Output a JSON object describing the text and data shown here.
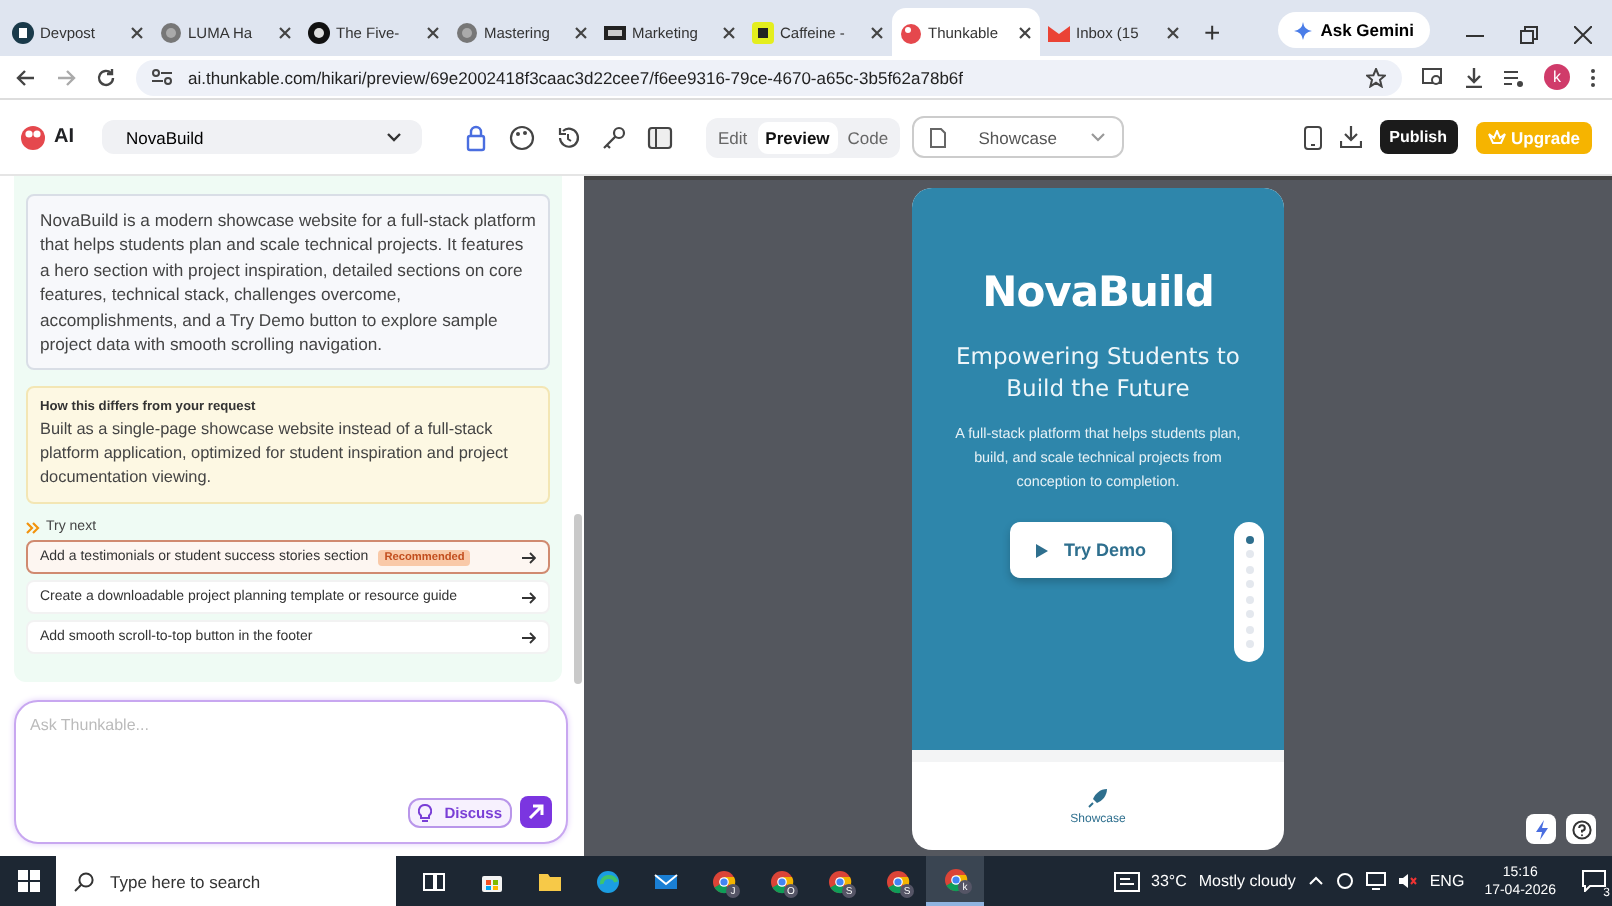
{
  "browser": {
    "tabs": [
      {
        "label": "Devpost",
        "selected": false,
        "kind": "d"
      },
      {
        "label": "LUMA Ha",
        "selected": false,
        "kind": "globe"
      },
      {
        "label": "The Five-",
        "selected": false,
        "kind": "circle"
      },
      {
        "label": "Mastering",
        "selected": false,
        "kind": "globe"
      },
      {
        "label": "Marketing",
        "selected": false,
        "kind": "wx"
      },
      {
        "label": "Caffeine -",
        "selected": false,
        "kind": "c"
      },
      {
        "label": "Thunkable",
        "selected": true,
        "kind": "thunk"
      },
      {
        "label": "Inbox (15",
        "selected": false,
        "kind": "mail"
      }
    ],
    "new_tab": "+",
    "ask_gemini": "Ask Gemini",
    "url": "ai.thunkable.com/hikari/preview/69e2002418f3caac3d22cee7/f6ee9316-79ce-4670-a65c-3b5f62a78b6f",
    "avatar": "k"
  },
  "app_toolbar": {
    "logo": "AI",
    "project": "NovaBuild",
    "modes": [
      {
        "label": "Edit",
        "selected": false
      },
      {
        "label": "Preview",
        "selected": true
      },
      {
        "label": "Code",
        "selected": false
      }
    ],
    "page_select": "Showcase",
    "publish": "Publish",
    "upgrade": "Upgrade"
  },
  "chat": {
    "summary": "NovaBuild is a modern showcase website for a full-stack platform that helps students plan and scale technical projects. It features a hero section with project inspiration, detailed sections on core features, technical stack, challenges overcome, accomplishments, and a Try Demo button to explore sample project data with smooth scrolling navigation.",
    "difference": {
      "title": "How this differs from your request",
      "body": "Built as a single-page showcase website instead of a full-stack platform application, optimized for student inspiration and project documentation viewing."
    },
    "try_next": {
      "title": "Try next",
      "suggestions": [
        {
          "text": "Add a testimonials or student success stories section",
          "badge": "Recommended",
          "recommended": true
        },
        {
          "text": "Create a downloadable project planning template or resource guide",
          "recommended": false
        },
        {
          "text": "Add smooth scroll-to-top button in the footer",
          "recommended": false
        }
      ]
    },
    "input": {
      "placeholder": "Ask Thunkable..."
    },
    "discuss": "Discuss"
  },
  "preview": {
    "title": "NovaBuild",
    "subtitle": "Empowering Students to Build the Future",
    "description": "A full-stack platform that helps students plan, build, and scale technical projects from conception to completion.",
    "button": "Try Demo",
    "section_dots": [
      {
        "selected": true
      },
      {
        "selected": false
      },
      {
        "selected": false
      },
      {
        "selected": false
      },
      {
        "selected": false
      },
      {
        "selected": false
      },
      {
        "selected": false
      },
      {
        "selected": false
      }
    ],
    "bottom_nav": [
      {
        "label": "Showcase",
        "selected": true
      }
    ]
  },
  "taskbar": {
    "search_placeholder": "Type here to search",
    "apps": [
      {
        "kind": "taskview"
      },
      {
        "kind": "store"
      },
      {
        "kind": "folder"
      },
      {
        "kind": "edge"
      },
      {
        "kind": "mail"
      },
      {
        "kind": "chrome",
        "badge": "J"
      },
      {
        "kind": "chrome",
        "badge": "O"
      },
      {
        "kind": "chrome",
        "badge": "S"
      },
      {
        "kind": "chrome",
        "badge": "S"
      },
      {
        "kind": "chrome",
        "badge": "k",
        "selected": true
      }
    ],
    "temperature": "33°C",
    "weather": "Mostly cloudy",
    "language": "ENG",
    "time": "15:16",
    "date": "17-04-2026",
    "notifications": "3"
  }
}
